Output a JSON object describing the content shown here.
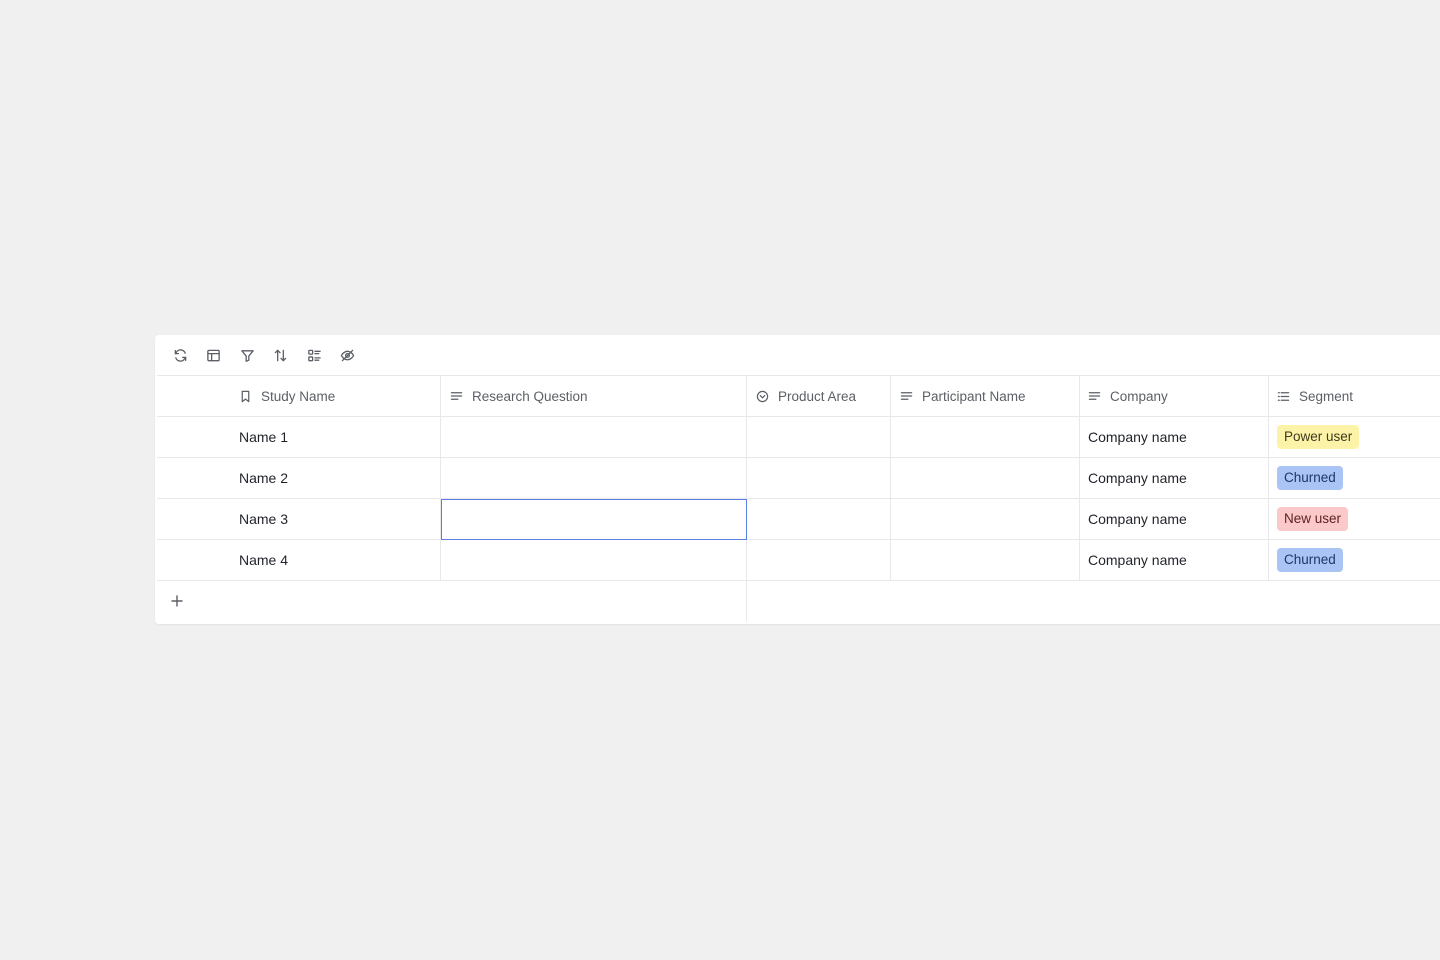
{
  "toolbar": {
    "buttons": [
      {
        "icon": "refresh-icon"
      },
      {
        "icon": "layout-icon"
      },
      {
        "icon": "filter-icon"
      },
      {
        "icon": "sort-icon"
      },
      {
        "icon": "group-icon"
      },
      {
        "icon": "hide-fields-icon"
      }
    ]
  },
  "columns": {
    "study_name": {
      "label": "Study Name",
      "icon": "bookmark-icon"
    },
    "research_question": {
      "label": "Research Question",
      "icon": "text-field-icon"
    },
    "product_area": {
      "label": "Product Area",
      "icon": "single-select-icon"
    },
    "participant_name": {
      "label": "Participant Name",
      "icon": "text-field-icon"
    },
    "company": {
      "label": "Company",
      "icon": "text-field-icon"
    },
    "segment": {
      "label": "Segment",
      "icon": "list-icon"
    }
  },
  "rows": [
    {
      "study_name": "Name 1",
      "research_question": "",
      "product_area": "",
      "participant_name": "",
      "company": "Company name",
      "segment": "Power user"
    },
    {
      "study_name": "Name 2",
      "research_question": "",
      "product_area": "",
      "participant_name": "",
      "company": "Company name",
      "segment": "Churned"
    },
    {
      "study_name": "Name 3",
      "research_question": "",
      "product_area": "",
      "participant_name": "",
      "company": "Company name",
      "segment": "New user",
      "selected_field": "research_question"
    },
    {
      "study_name": "Name 4",
      "research_question": "",
      "product_area": "",
      "participant_name": "",
      "company": "Company name",
      "segment": "Churned"
    }
  ],
  "segment_colors": {
    "Power user": {
      "bg": "#fdf3a8",
      "fg": "#3d3a1f"
    },
    "Churned": {
      "bg": "#a9c4f5",
      "fg": "#1f3766"
    },
    "New user": {
      "bg": "#fbc9c9",
      "fg": "#5e1f1f"
    }
  },
  "add_row_icon": "plus-icon"
}
